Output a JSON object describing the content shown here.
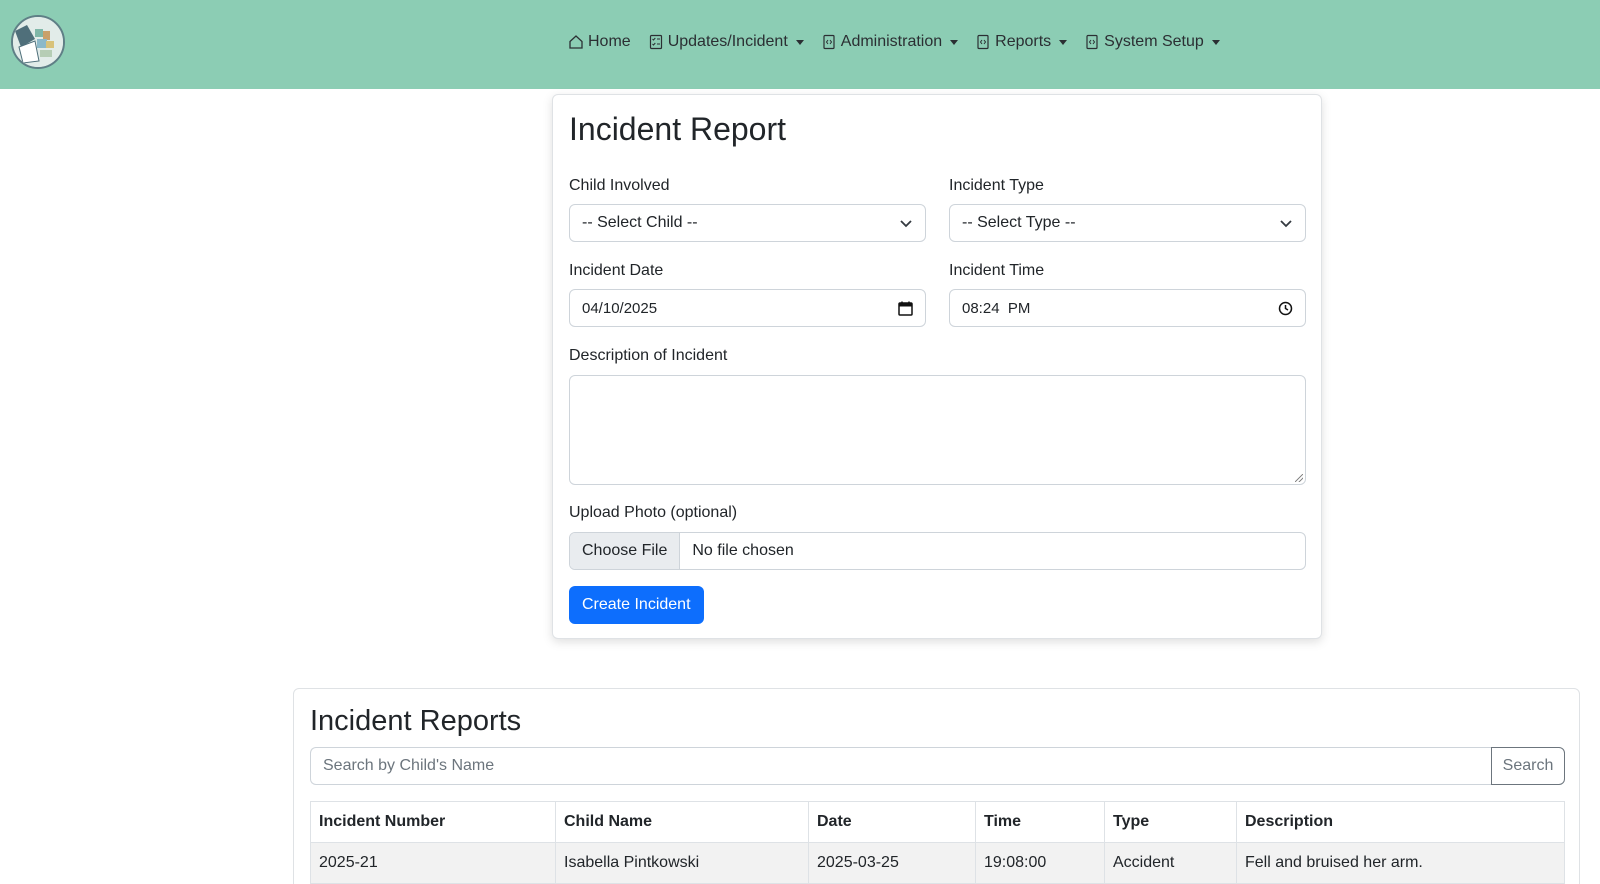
{
  "nav": {
    "items": [
      {
        "label": "Home",
        "icon": "home-icon",
        "dropdown": false
      },
      {
        "label": "Updates/Incident",
        "icon": "checklist-icon",
        "dropdown": true
      },
      {
        "label": "Administration",
        "icon": "file-code-icon",
        "dropdown": true
      },
      {
        "label": "Reports",
        "icon": "file-code-icon",
        "dropdown": true
      },
      {
        "label": "System Setup",
        "icon": "file-code-icon",
        "dropdown": true
      }
    ]
  },
  "form": {
    "title": "Incident Report",
    "child_label": "Child Involved",
    "child_value": "-- Select Child --",
    "type_label": "Incident Type",
    "type_value": "-- Select Type --",
    "date_label": "Incident Date",
    "date_value": "04/10/2025",
    "time_label": "Incident Time",
    "time_value": "08:24  PM",
    "description_label": "Description of Incident",
    "description_value": "",
    "photo_label": "Upload Photo (optional)",
    "choose_file": "Choose File",
    "no_file": "No file chosen",
    "submit": "Create Incident"
  },
  "reports": {
    "title": "Incident Reports",
    "search_placeholder": "Search by Child's Name",
    "search_button": "Search",
    "columns": [
      "Incident Number",
      "Child Name",
      "Date",
      "Time",
      "Type",
      "Description"
    ],
    "rows": [
      [
        "2025-21",
        "Isabella Pintkowski",
        "2025-03-25",
        "19:08:00",
        "Accident",
        "Fell and bruised her arm."
      ]
    ]
  },
  "colors": {
    "navbar": "#8ccdb4",
    "primary": "#0d6efd"
  }
}
